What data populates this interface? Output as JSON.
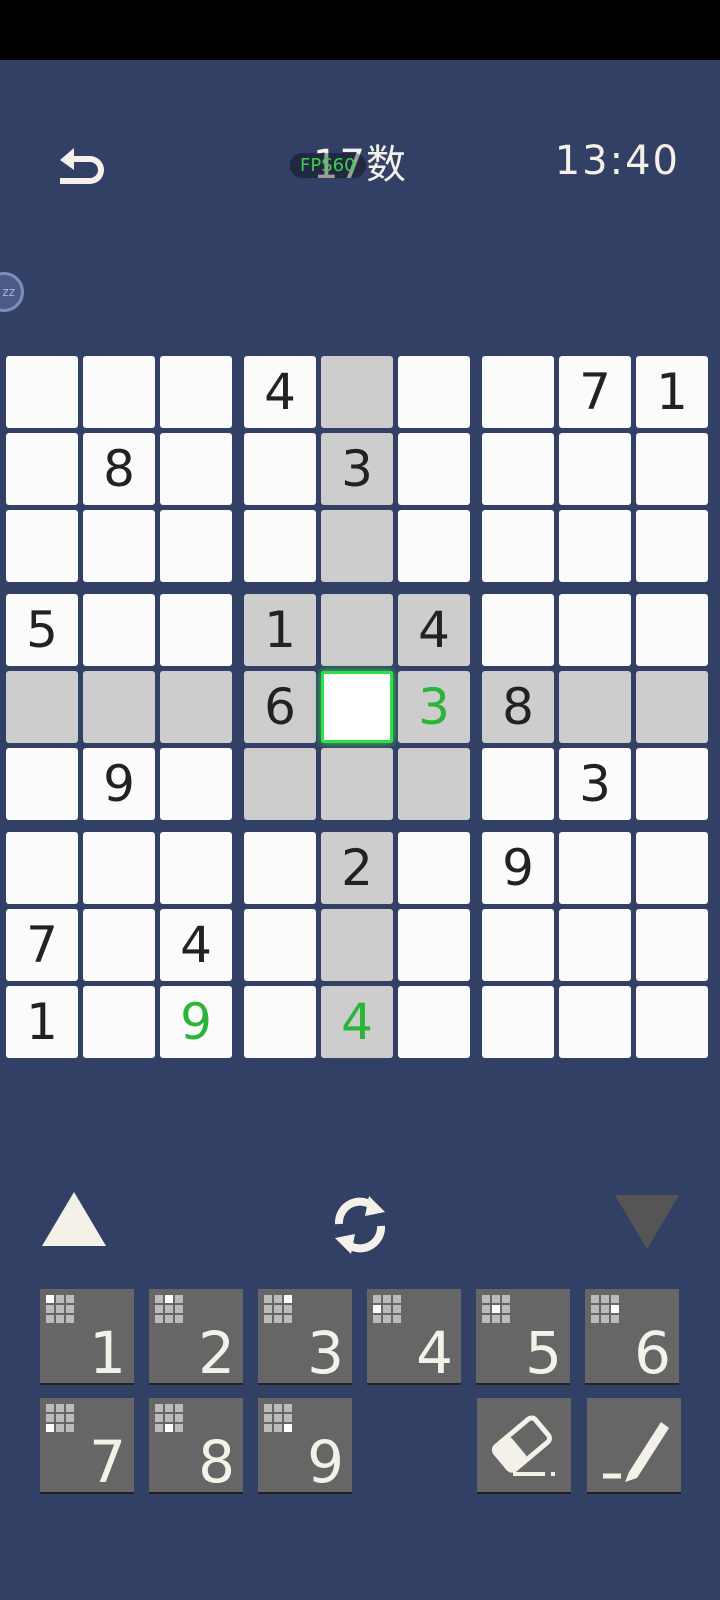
{
  "header": {
    "title": "17数",
    "fps_label": "FPS60",
    "timer": "13:40",
    "sleep_label": "zz"
  },
  "board": {
    "rows": [
      [
        {
          "v": "",
          "hl": false
        },
        {
          "v": "",
          "hl": false
        },
        {
          "v": "",
          "hl": false
        },
        {
          "v": "4",
          "hl": false
        },
        {
          "v": "",
          "hl": true
        },
        {
          "v": "",
          "hl": false
        },
        {
          "v": "",
          "hl": false
        },
        {
          "v": "7",
          "hl": false
        },
        {
          "v": "1",
          "hl": false
        }
      ],
      [
        {
          "v": "",
          "hl": false
        },
        {
          "v": "8",
          "hl": false
        },
        {
          "v": "",
          "hl": false
        },
        {
          "v": "",
          "hl": false
        },
        {
          "v": "3",
          "hl": true
        },
        {
          "v": "",
          "hl": false
        },
        {
          "v": "",
          "hl": false
        },
        {
          "v": "",
          "hl": false
        },
        {
          "v": "",
          "hl": false
        }
      ],
      [
        {
          "v": "",
          "hl": false
        },
        {
          "v": "",
          "hl": false
        },
        {
          "v": "",
          "hl": false
        },
        {
          "v": "",
          "hl": false
        },
        {
          "v": "",
          "hl": true
        },
        {
          "v": "",
          "hl": false
        },
        {
          "v": "",
          "hl": false
        },
        {
          "v": "",
          "hl": false
        },
        {
          "v": "",
          "hl": false
        }
      ],
      [
        {
          "v": "5",
          "hl": false
        },
        {
          "v": "",
          "hl": false
        },
        {
          "v": "",
          "hl": false
        },
        {
          "v": "1",
          "hl": true
        },
        {
          "v": "",
          "hl": true
        },
        {
          "v": "4",
          "hl": true
        },
        {
          "v": "",
          "hl": false
        },
        {
          "v": "",
          "hl": false
        },
        {
          "v": "",
          "hl": false
        }
      ],
      [
        {
          "v": "",
          "hl": true
        },
        {
          "v": "",
          "hl": true
        },
        {
          "v": "",
          "hl": true
        },
        {
          "v": "6",
          "hl": true
        },
        {
          "v": "",
          "hl": true,
          "sel": true
        },
        {
          "v": "3",
          "hl": true,
          "user": true
        },
        {
          "v": "8",
          "hl": true
        },
        {
          "v": "",
          "hl": true
        },
        {
          "v": "",
          "hl": true
        }
      ],
      [
        {
          "v": "",
          "hl": false
        },
        {
          "v": "9",
          "hl": false
        },
        {
          "v": "",
          "hl": false
        },
        {
          "v": "",
          "hl": true
        },
        {
          "v": "",
          "hl": true
        },
        {
          "v": "",
          "hl": true
        },
        {
          "v": "",
          "hl": false
        },
        {
          "v": "3",
          "hl": false
        },
        {
          "v": "",
          "hl": false
        }
      ],
      [
        {
          "v": "",
          "hl": false
        },
        {
          "v": "",
          "hl": false
        },
        {
          "v": "",
          "hl": false
        },
        {
          "v": "",
          "hl": false
        },
        {
          "v": "2",
          "hl": true
        },
        {
          "v": "",
          "hl": false
        },
        {
          "v": "9",
          "hl": false
        },
        {
          "v": "",
          "hl": false
        },
        {
          "v": "",
          "hl": false
        }
      ],
      [
        {
          "v": "7",
          "hl": false
        },
        {
          "v": "",
          "hl": false
        },
        {
          "v": "4",
          "hl": false
        },
        {
          "v": "",
          "hl": false
        },
        {
          "v": "",
          "hl": true
        },
        {
          "v": "",
          "hl": false
        },
        {
          "v": "",
          "hl": false
        },
        {
          "v": "",
          "hl": false
        },
        {
          "v": "",
          "hl": false
        }
      ],
      [
        {
          "v": "1",
          "hl": false
        },
        {
          "v": "",
          "hl": false
        },
        {
          "v": "9",
          "hl": false,
          "user": true
        },
        {
          "v": "",
          "hl": false
        },
        {
          "v": "4",
          "hl": true,
          "user": true
        },
        {
          "v": "",
          "hl": false
        },
        {
          "v": "",
          "hl": false
        },
        {
          "v": "",
          "hl": false
        },
        {
          "v": "",
          "hl": false
        }
      ]
    ]
  },
  "keypad": {
    "digits": [
      "1",
      "2",
      "3",
      "4",
      "5",
      "6",
      "7",
      "8",
      "9"
    ]
  },
  "tools": {
    "eraser": "eraser-icon",
    "pencil": "pencil-icon"
  },
  "colors": {
    "background": "#334066",
    "cell": "#fbfbfb",
    "highlight": "#cdcdcd",
    "user_digit": "#2bb43a",
    "selection": "#2ee043",
    "key": "#666666"
  }
}
